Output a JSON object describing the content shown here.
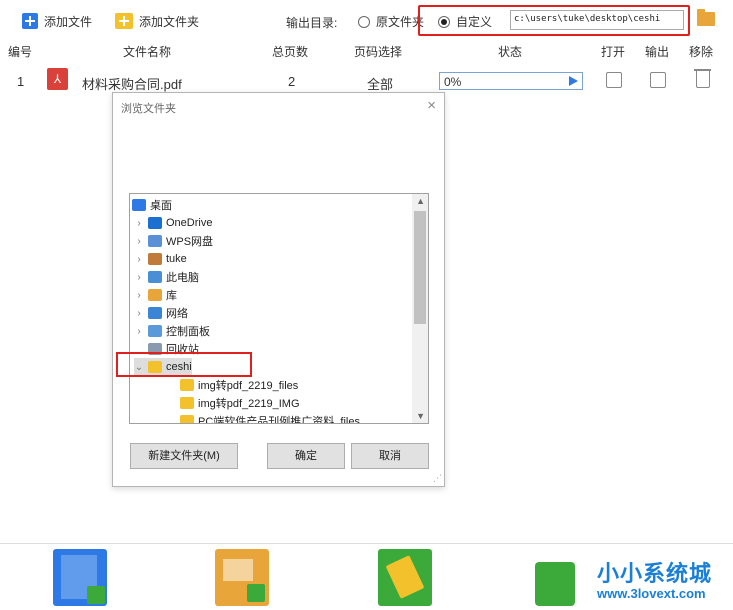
{
  "toolbar": {
    "add_file": "添加文件",
    "add_folder": "添加文件夹",
    "output_dir_label": "输出目录:",
    "radio_original": "原文件夹",
    "radio_custom": "自定义",
    "output_path": "c:\\users\\tuke\\desktop\\ceshi"
  },
  "table": {
    "headers": [
      "编号",
      "文件名称",
      "总页数",
      "页码选择",
      "状态",
      "打开",
      "输出",
      "移除"
    ],
    "rows": [
      {
        "index": "1",
        "filename": "材料采购合同.pdf",
        "pages": "2",
        "page_select": "全部",
        "status": "0%"
      }
    ]
  },
  "dialog": {
    "title": "浏览文件夹",
    "close": "×",
    "tree": [
      {
        "label": "桌面",
        "icon": "desktop-icon",
        "indent": 0,
        "chevron": ""
      },
      {
        "label": "OneDrive",
        "icon": "onedrive-icon",
        "indent": 1,
        "chevron": "›"
      },
      {
        "label": "WPS网盘",
        "icon": "cloud-icon",
        "indent": 1,
        "chevron": "›"
      },
      {
        "label": "tuke",
        "icon": "user-icon",
        "indent": 1,
        "chevron": "›"
      },
      {
        "label": "此电脑",
        "icon": "computer-icon",
        "indent": 1,
        "chevron": "›"
      },
      {
        "label": "库",
        "icon": "library-icon",
        "indent": 1,
        "chevron": "›"
      },
      {
        "label": "网络",
        "icon": "network-icon",
        "indent": 1,
        "chevron": "›"
      },
      {
        "label": "控制面板",
        "icon": "control-panel-icon",
        "indent": 1,
        "chevron": "›"
      },
      {
        "label": "回收站",
        "icon": "recycle-bin-icon",
        "indent": 1,
        "chevron": ""
      },
      {
        "label": "ceshi",
        "icon": "folder-icon",
        "indent": 1,
        "chevron": "⌄"
      },
      {
        "label": "img转pdf_2219_files",
        "icon": "folder-icon",
        "indent": 2,
        "chevron": ""
      },
      {
        "label": "img转pdf_2219_IMG",
        "icon": "folder-icon",
        "indent": 2,
        "chevron": ""
      },
      {
        "label": "PC端软件产品刊例推广资料_files",
        "icon": "folder-icon",
        "indent": 2,
        "chevron": ""
      }
    ],
    "btn_new_folder": "新建文件夹(M)",
    "btn_ok": "确定",
    "btn_cancel": "取消"
  },
  "watermark": {
    "text": "小小系统城",
    "url": "www.3lovext.com"
  },
  "colors": {
    "accent": "#2d7ae6",
    "highlight": "#e0201d",
    "folder": "#f3c12b"
  }
}
